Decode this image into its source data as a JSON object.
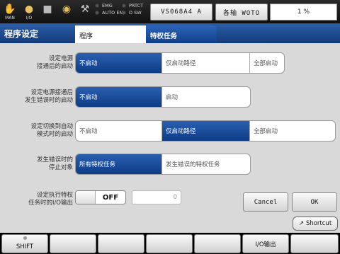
{
  "topbar": {
    "icons": [
      {
        "name": "hand-icon",
        "label": "MAN"
      },
      {
        "name": "io-icon",
        "label": "I/O"
      },
      {
        "name": "stop-square-icon",
        "label": ""
      },
      {
        "name": "bulb-icon",
        "label": ""
      },
      {
        "name": "wrench-icon",
        "label": ""
      }
    ],
    "lamps_left": [
      "EMG",
      "AUTO EN"
    ],
    "lamps_right": [
      "PRTCT",
      "D SW"
    ],
    "robot": "VS068A4 A",
    "axes": "各轴 WOTO",
    "speed": "1 %"
  },
  "header": {
    "title": "程序设定",
    "tabs": [
      {
        "label": "程序",
        "active": false
      },
      {
        "label": "特权任务",
        "active": true
      }
    ]
  },
  "settings": [
    {
      "label_lines": [
        "设定电源",
        "接通后的启动"
      ],
      "options": [
        "不启动",
        "仅启动路径",
        "全部启动"
      ],
      "selected": 0
    },
    {
      "label_lines": [
        "设定电源接通后",
        "发生错误时的启动"
      ],
      "options": [
        "不启动",
        "启动"
      ],
      "selected": 0
    },
    {
      "label_lines": [
        "设定切换到自动",
        "模式时的启动"
      ],
      "options": [
        "不启动",
        "仅启动路径",
        "全部启动"
      ],
      "selected": 1
    },
    {
      "label_lines": [
        "发生错误时的",
        "停止对象"
      ],
      "options": [
        "所有特权任务",
        "发生错误的特权任务"
      ],
      "selected": 0
    }
  ],
  "io_setting": {
    "label_lines": [
      "设定执行特权",
      "任务时的I/O输出"
    ],
    "toggle": "OFF",
    "value": "0"
  },
  "buttons": {
    "cancel": "Cancel",
    "ok": "OK"
  },
  "shortcut": "Shortcut",
  "fkeys": [
    "SHIFT",
    "",
    "",
    "",
    "",
    "I/O输出",
    ""
  ],
  "colors": {
    "accent": "#1a4b95",
    "selected": "#0d3c86"
  }
}
